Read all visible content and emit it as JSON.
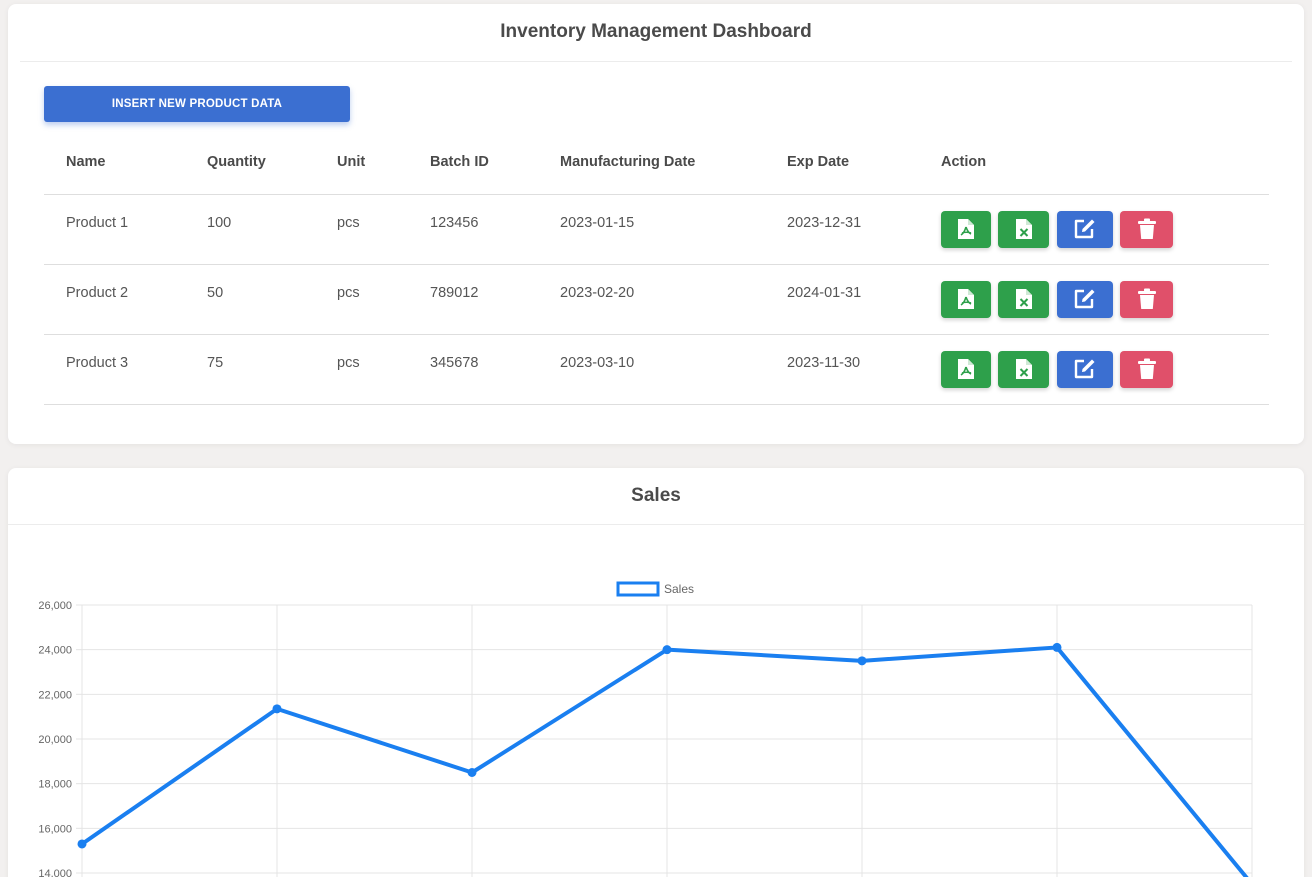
{
  "inventory": {
    "title": "Inventory Management Dashboard",
    "insert_button": "INSERT NEW PRODUCT DATA",
    "columns": [
      "Name",
      "Quantity",
      "Unit",
      "Batch ID",
      "Manufacturing Date",
      "Exp Date",
      "Action"
    ],
    "rows": [
      {
        "name": "Product 1",
        "quantity": "100",
        "unit": "pcs",
        "batch_id": "123456",
        "mfg_date": "2023-01-15",
        "exp_date": "2023-12-31"
      },
      {
        "name": "Product 2",
        "quantity": "50",
        "unit": "pcs",
        "batch_id": "789012",
        "mfg_date": "2023-02-20",
        "exp_date": "2024-01-31"
      },
      {
        "name": "Product 3",
        "quantity": "75",
        "unit": "pcs",
        "batch_id": "345678",
        "mfg_date": "2023-03-10",
        "exp_date": "2023-11-30"
      }
    ],
    "action_icons": [
      "pdf-file-icon",
      "excel-file-icon",
      "edit-icon",
      "trash-icon"
    ],
    "colors": {
      "primary": "#3b6fd1",
      "success": "#2ea04b",
      "danger": "#e0506a"
    }
  },
  "sales": {
    "title": "Sales"
  },
  "chart_data": {
    "type": "line",
    "title": "",
    "series": [
      {
        "name": "Sales",
        "values": [
          15300,
          21350,
          18500,
          24000,
          23500,
          24100,
          13500
        ]
      }
    ],
    "ylim": [
      14000,
      26000
    ],
    "yticks": [
      "26,000",
      "24,000",
      "22,000",
      "20,000",
      "18,000",
      "16,000",
      "14,000"
    ],
    "grid": true,
    "legend": "top-center",
    "color": "#1a7ff0"
  }
}
